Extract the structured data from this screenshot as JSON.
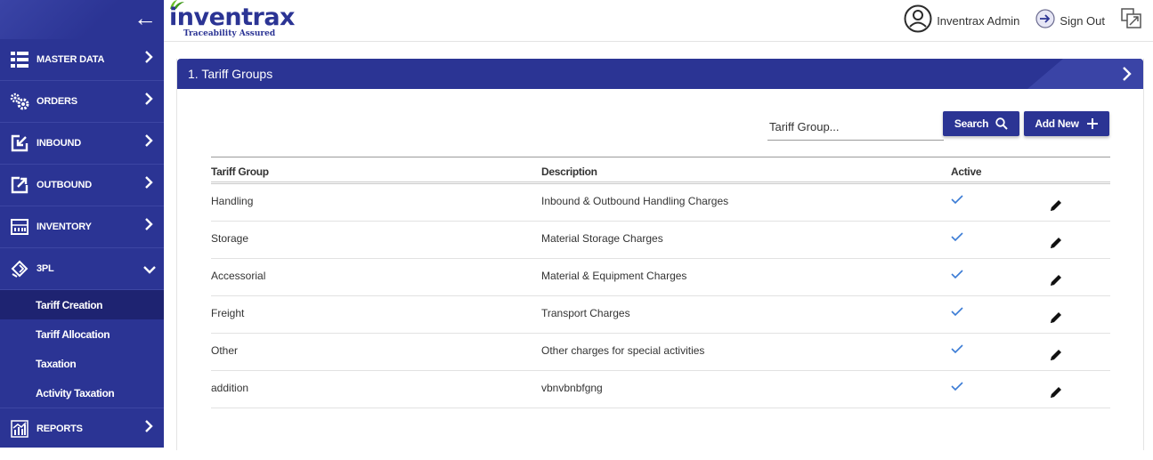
{
  "header": {
    "logo_text": "inventrax",
    "logo_tagline": "Traceability Assured",
    "user_label": "Inventrax Admin",
    "signout_label": "Sign Out"
  },
  "sidebar": {
    "items": [
      {
        "label": "MASTER DATA",
        "icon": "grid-list-icon"
      },
      {
        "label": "ORDERS",
        "icon": "gears-icon"
      },
      {
        "label": "INBOUND",
        "icon": "inbound-icon"
      },
      {
        "label": "OUTBOUND",
        "icon": "outbound-icon"
      },
      {
        "label": "INVENTORY",
        "icon": "inventory-icon"
      },
      {
        "label": "3PL",
        "icon": "diamond-icon"
      }
    ],
    "sub_items": [
      {
        "label": "Tariff Creation",
        "active": true
      },
      {
        "label": "Tariff Allocation",
        "active": false
      },
      {
        "label": "Taxation",
        "active": false
      },
      {
        "label": "Activity Taxation",
        "active": false
      }
    ],
    "reports": {
      "label": "REPORTS",
      "icon": "chart-icon"
    }
  },
  "panel": {
    "title": "1. Tariff Groups",
    "search_placeholder": "Tariff Group...",
    "search_label": "Search",
    "add_label": "Add New"
  },
  "table": {
    "columns": [
      "Tariff Group",
      "Description",
      "Active"
    ],
    "rows": [
      {
        "group": "Handling",
        "description": "Inbound & Outbound Handling Charges",
        "active": true
      },
      {
        "group": "Storage",
        "description": "Material Storage Charges",
        "active": true
      },
      {
        "group": "Accessorial",
        "description": "Material & Equipment Charges",
        "active": true
      },
      {
        "group": "Freight",
        "description": "Transport Charges",
        "active": true
      },
      {
        "group": "Other",
        "description": "Other charges for special activities",
        "active": true
      },
      {
        "group": "addition",
        "description": "vbnvbnbfgng",
        "active": true
      }
    ]
  },
  "colors": {
    "primary": "#2b3494",
    "active_sub": "#1e2371",
    "check": "#3a7bd5"
  }
}
